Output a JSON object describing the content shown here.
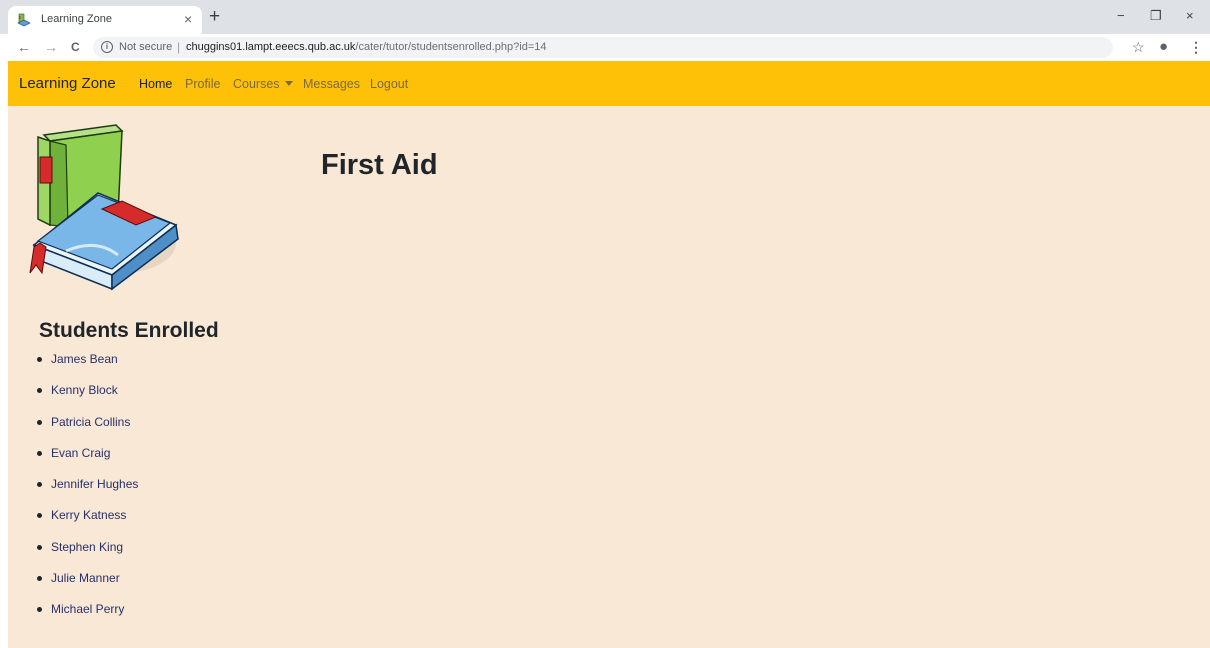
{
  "browser": {
    "tab_title": "Learning Zone",
    "tab_close": "×",
    "new_tab": "+",
    "window_controls": {
      "minimize": "−",
      "restore": "❐",
      "close": "×"
    },
    "nav": {
      "back": "←",
      "forward": "→",
      "reload": "C"
    },
    "security_label": "Not secure",
    "separator": "|",
    "url_host": "chuggins01.lampt.eeecs.qub.ac.uk",
    "url_path": "/cater/tutor/studentsenrolled.php?id=14",
    "bookmark_star": "☆",
    "account": "●",
    "menu": "⋮"
  },
  "navbar": {
    "brand": "Learning Zone",
    "links": [
      "Home",
      "Profile",
      "Courses",
      "Messages",
      "Logout"
    ],
    "active": "Home"
  },
  "course": {
    "title": "First Aid"
  },
  "enrolled": {
    "title": "Students Enrolled",
    "students": [
      "James Bean",
      "Kenny Block",
      "Patricia Collins",
      "Evan Craig",
      "Jennifer Hughes",
      "Kerry Katness",
      "Stephen King",
      "Julie Manner",
      "Michael Perry"
    ]
  },
  "colors": {
    "navbar": "#ffc107",
    "page_bg": "#f9e8d6",
    "link_text": "#26316a"
  },
  "icons": {
    "favicon": "books-icon",
    "logo": "books-logo-icon"
  }
}
